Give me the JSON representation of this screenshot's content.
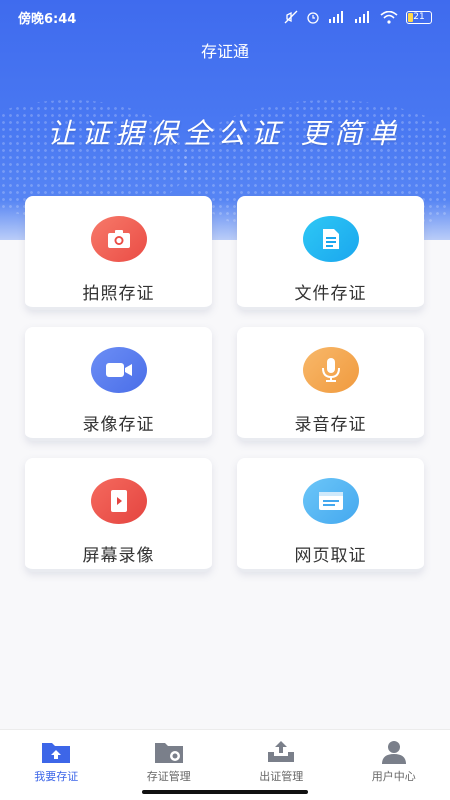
{
  "status_bar": {
    "time": "傍晚6:44",
    "battery": "21"
  },
  "header": {
    "title": "存证通",
    "slogan": "让证据保全公证 更简单"
  },
  "features": [
    {
      "label": "拍照存证",
      "icon": "camera-icon",
      "color": "#ea4c45"
    },
    {
      "label": "文件存证",
      "icon": "document-icon",
      "color": "#1aa6ee"
    },
    {
      "label": "录像存证",
      "icon": "video-camera-icon",
      "color": "#4a6ee8"
    },
    {
      "label": "录音存证",
      "icon": "microphone-icon",
      "color": "#f09a3e"
    },
    {
      "label": "屏幕录像",
      "icon": "screen-record-icon",
      "color": "#e44440"
    },
    {
      "label": "网页取证",
      "icon": "webpage-icon",
      "color": "#44a8ef"
    }
  ],
  "tabbar": {
    "items": [
      {
        "label": "我要存证",
        "icon": "upload-folder-icon",
        "active": true
      },
      {
        "label": "存证管理",
        "icon": "folder-manage-icon",
        "active": false
      },
      {
        "label": "出证管理",
        "icon": "export-tray-icon",
        "active": false
      },
      {
        "label": "用户中心",
        "icon": "user-icon",
        "active": false
      }
    ]
  },
  "colors": {
    "primary": "#3d66e8",
    "inactive": "#7a7f8a"
  }
}
